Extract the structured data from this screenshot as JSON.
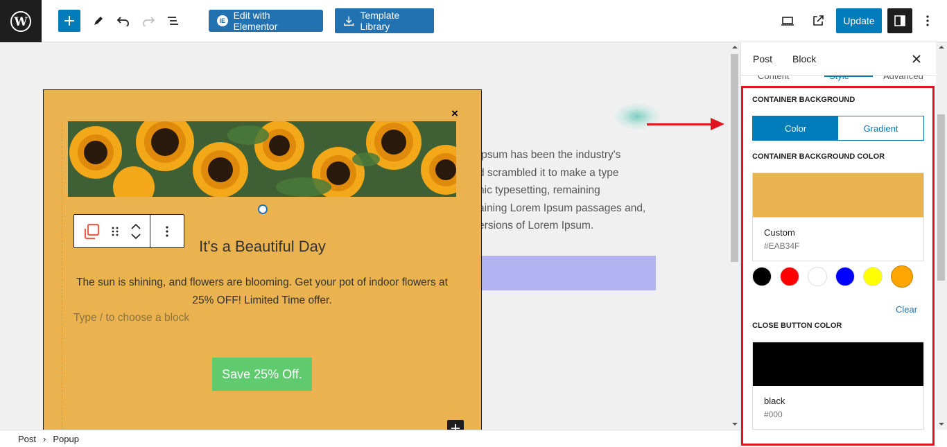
{
  "toolbar": {
    "edit_elementor_label": "Edit with Elementor",
    "template_library_label": "Template Library",
    "update_label": "Update"
  },
  "canvas": {
    "bg_text_lines": [
      "Ipsum has been the industry's",
      "d scrambled it to make a type",
      "nic typesetting, remaining",
      "aining Lorem Ipsum passages and,",
      "ersions of Lorem Ipsum."
    ],
    "popup": {
      "close_glyph": "×",
      "title": "It's a Beautiful Day",
      "description": "The sun is shining, and flowers are blooming. Get your pot of indoor flowers at 25% OFF! Limited Time offer.",
      "placeholder": "Type / to choose a block",
      "button_label": "Save 25% Off.",
      "background_color": "#eab34f",
      "button_color": "#5fcb6e"
    }
  },
  "breadcrumb": {
    "items": [
      "Post",
      "Popup"
    ],
    "separator": "›"
  },
  "panel": {
    "tabs": [
      "Post",
      "Block"
    ],
    "sub_tabs": [
      "Content",
      "Style",
      "Advanced"
    ],
    "container_background_label": "CONTAINER BACKGROUND",
    "bg_types": [
      "Color",
      "Gradient"
    ],
    "container_bg_color_label": "CONTAINER BACKGROUND COLOR",
    "container_bg_color": {
      "name": "Custom",
      "hex": "#EAB34F"
    },
    "palette": [
      "#000000",
      "#ff0000",
      "#ffffff",
      "#0000ff",
      "#ffff00",
      "#ffa500"
    ],
    "clear_label": "Clear",
    "close_button_color_label": "CLOSE BUTTON COLOR",
    "close_button_color": {
      "name": "black",
      "hex": "#000"
    }
  }
}
